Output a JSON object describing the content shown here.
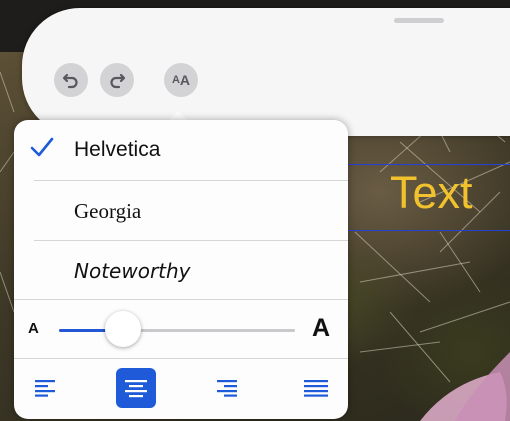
{
  "colors": {
    "accent": "#1f5bd8",
    "text_yellow": "#f1c22e",
    "guide_blue": "#2340d8"
  },
  "toolbar": {
    "undo_icon": "undo-icon",
    "redo_icon": "redo-icon",
    "text_style_label_small": "A",
    "text_style_label_big": "A"
  },
  "canvas": {
    "text": "Text"
  },
  "font_menu": {
    "fonts": [
      {
        "label": "Helvetica",
        "selected": true
      },
      {
        "label": "Georgia",
        "selected": false
      },
      {
        "label": "Noteworthy",
        "selected": false
      }
    ]
  },
  "size": {
    "small_label": "A",
    "large_label": "A",
    "value_fraction": 0.27
  },
  "alignment": {
    "options": [
      "left",
      "center",
      "right",
      "justify"
    ],
    "selected": "center"
  }
}
